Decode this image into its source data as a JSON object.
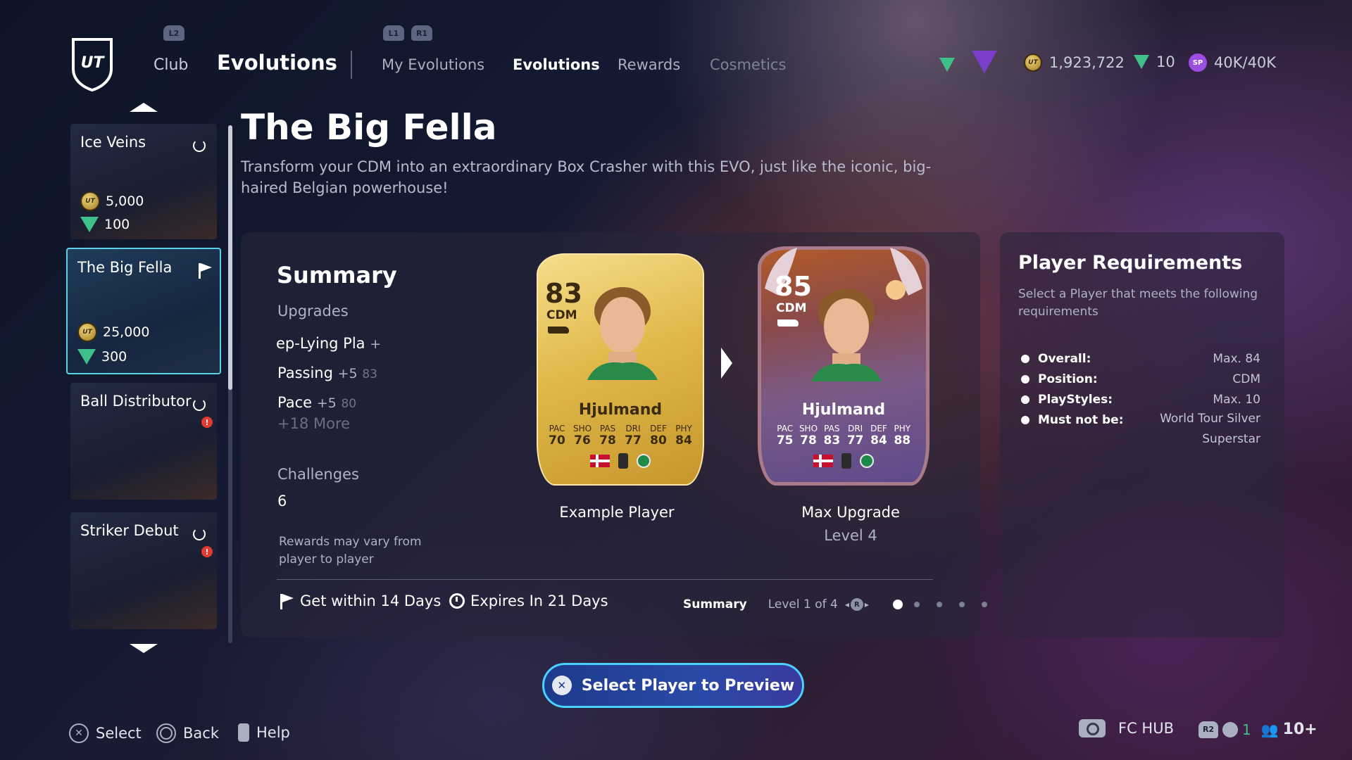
{
  "nav": {
    "shoulder_left": "L2",
    "shoulder_l1": "L1",
    "shoulder_r1": "R1",
    "club": "Club",
    "evolutions": "Evolutions",
    "tabs": [
      "My Evolutions",
      "Evolutions",
      "Rewards",
      "Cosmetics"
    ],
    "active_tab": "Evolutions"
  },
  "currency": {
    "coins": "1,923,722",
    "points": "10",
    "sp": "40K/40K",
    "coin_icon_text": "UT",
    "sp_icon_text": "SP"
  },
  "evo_list": [
    {
      "title": "Ice Veins",
      "coins": "5,000",
      "points": "100",
      "state": "repeatable",
      "selected": false
    },
    {
      "title": "The Big Fella",
      "coins": "25,000",
      "points": "300",
      "state": "active",
      "selected": true
    },
    {
      "title": "Ball Distributor",
      "alert": "!",
      "state": "repeatable",
      "selected": false
    },
    {
      "title": "Striker Debut",
      "alert": "!",
      "state": "repeatable",
      "selected": false
    }
  ],
  "detail": {
    "title": "The Big Fella",
    "description": "Transform your CDM into an extraordinary Box Crasher with this EVO, just like the iconic, big-haired Belgian powerhouse!"
  },
  "summary": {
    "heading": "Summary",
    "upgrades_label": "Upgrades",
    "upgrades": [
      {
        "name": "ep-Lying Pla",
        "plus": "+",
        "max": ""
      },
      {
        "name": "Passing",
        "plus": "+5",
        "max": "83"
      },
      {
        "name": "Pace",
        "plus": "+5",
        "max": "80"
      }
    ],
    "more": "+18 More",
    "challenges_label": "Challenges",
    "challenges_value": "6",
    "note": "Rewards may vary from player to player"
  },
  "cards": {
    "example": {
      "rating": "83",
      "position": "CDM",
      "name": "Hjulmand",
      "stat_keys": [
        "PAC",
        "SHO",
        "PAS",
        "DRI",
        "DEF",
        "PHY"
      ],
      "stat_values": [
        "70",
        "76",
        "78",
        "77",
        "80",
        "84"
      ],
      "caption": "Example Player"
    },
    "max": {
      "rating": "85",
      "position": "CDM",
      "name": "Hjulmand",
      "stat_keys": [
        "PAC",
        "SHO",
        "PAS",
        "DRI",
        "DEF",
        "PHY"
      ],
      "stat_values": [
        "75",
        "78",
        "83",
        "77",
        "84",
        "88"
      ],
      "caption": "Max Upgrade",
      "sub": "Level 4"
    }
  },
  "footer_info": {
    "get_within": "Get within 14 Days",
    "expires": "Expires In 21 Days",
    "pager_summary": "Summary",
    "pager_level": "Level 1 of 4",
    "pager_button": "R",
    "dots": 5,
    "active_dot": 0
  },
  "requirements": {
    "title": "Player Requirements",
    "description": "Select a Player that meets the following requirements",
    "rows": [
      {
        "key": "Overall:",
        "value": "Max. 84"
      },
      {
        "key": "Position:",
        "value": "CDM"
      },
      {
        "key": "PlayStyles:",
        "value": "Max. 10"
      },
      {
        "key": "Must not be:",
        "value": "World Tour Silver Superstar"
      }
    ]
  },
  "cta": {
    "label": "Select Player to Preview",
    "icon_text": "✕"
  },
  "bottom_bar": {
    "select": "Select",
    "back": "Back",
    "help": "Help",
    "fc_hub": "FC HUB",
    "r2": "R2",
    "count": "1",
    "friends": "10+"
  },
  "colors": {
    "accent_cyan": "#5bd2e8",
    "alert_red": "#e23a2f",
    "points_green": "#3fbf8a",
    "sp_purple": "#9b4ee0"
  }
}
